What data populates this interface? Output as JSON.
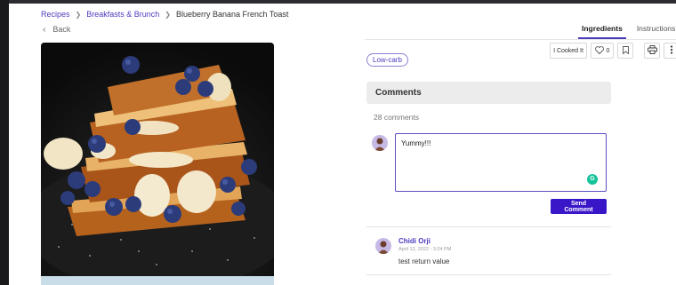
{
  "breadcrumb": {
    "items": [
      "Recipes",
      "Breakfasts & Brunch",
      "Blueberry Banana French Toast"
    ],
    "separator": ">"
  },
  "back": {
    "label": "Back"
  },
  "tabs": [
    {
      "label": "Ingredients",
      "active": true
    },
    {
      "label": "Instructions",
      "active": false
    }
  ],
  "actions": {
    "cooked_label": "I Cooked It",
    "likes": "0"
  },
  "tag": {
    "label": "Low-carb"
  },
  "comments": {
    "title": "Comments",
    "count_text": "28 comments",
    "input_value": "Yummy!!!",
    "send_label": "Send Comment",
    "items": [
      {
        "author": "Chidi Orji",
        "date": "April 12, 2022 - 3:24 PM",
        "text": "test return value"
      }
    ]
  },
  "colors": {
    "accent": "#4b3bbf",
    "send_button": "#3a16c9",
    "grammarly": "#15c39a"
  },
  "icons": [
    "chevron-right-icon",
    "chevron-left-icon",
    "heart-icon",
    "bookmark-icon",
    "print-icon",
    "more-icon",
    "grammarly-icon"
  ]
}
